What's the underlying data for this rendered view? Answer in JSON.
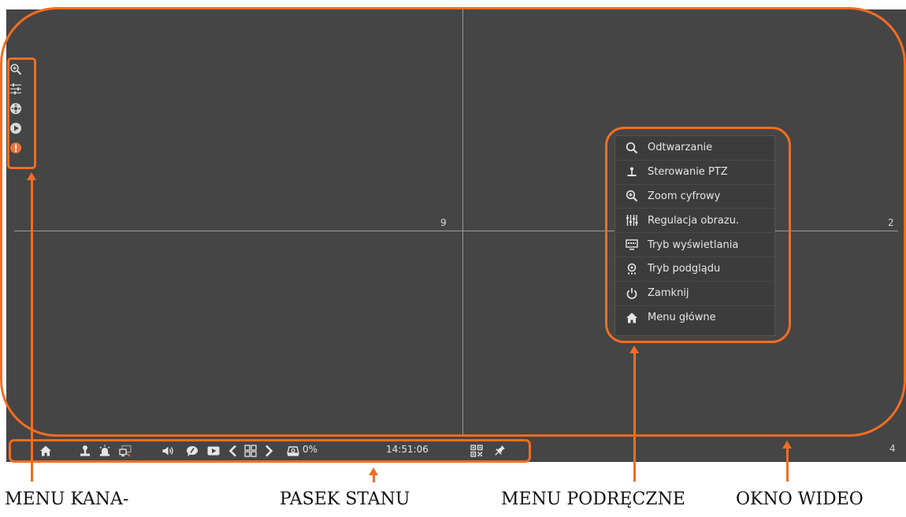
{
  "video_grid": {
    "channels": [
      "9",
      "2",
      "4"
    ]
  },
  "channel_menu": {
    "items": [
      {
        "icon": "zoom-in-icon"
      },
      {
        "icon": "sliders-icon"
      },
      {
        "icon": "ptz-wheel-icon"
      },
      {
        "icon": "play-icon"
      },
      {
        "icon": "info-icon"
      }
    ]
  },
  "context_menu": {
    "items": [
      {
        "label": "Odtwarzanie",
        "icon": "search-icon"
      },
      {
        "label": "Sterowanie PTZ",
        "icon": "ptz-joystick-icon"
      },
      {
        "label": "Zoom cyfrowy",
        "icon": "zoom-in-icon"
      },
      {
        "label": "Regulacja obrazu.",
        "icon": "sliders-icon"
      },
      {
        "label": "Tryb wyświetlania",
        "icon": "display-mode-icon"
      },
      {
        "label": "Tryb podglądu",
        "icon": "preview-mode-icon"
      },
      {
        "label": "Zamknij",
        "icon": "power-icon"
      },
      {
        "label": "Menu główne",
        "icon": "home-icon"
      }
    ]
  },
  "status_bar": {
    "disk_usage": "0%",
    "clock": "14:51:06",
    "icons": [
      "home-icon",
      "user-icon",
      "alarm-icon",
      "network-icon",
      "volume-icon",
      "record-icon",
      "playback-icon",
      "prev-icon",
      "layout-grid-icon",
      "next-icon",
      "hdd-icon",
      "qr-code-icon",
      "pin-icon"
    ]
  },
  "annotations": {
    "accent_color": "#f26d21",
    "captions": {
      "channel_menu": "MENU KANA-",
      "status_bar": "PASEK STANU",
      "context_menu": "MENU PODRĘCZNE",
      "video_window": "OKNO WIDEO"
    }
  }
}
